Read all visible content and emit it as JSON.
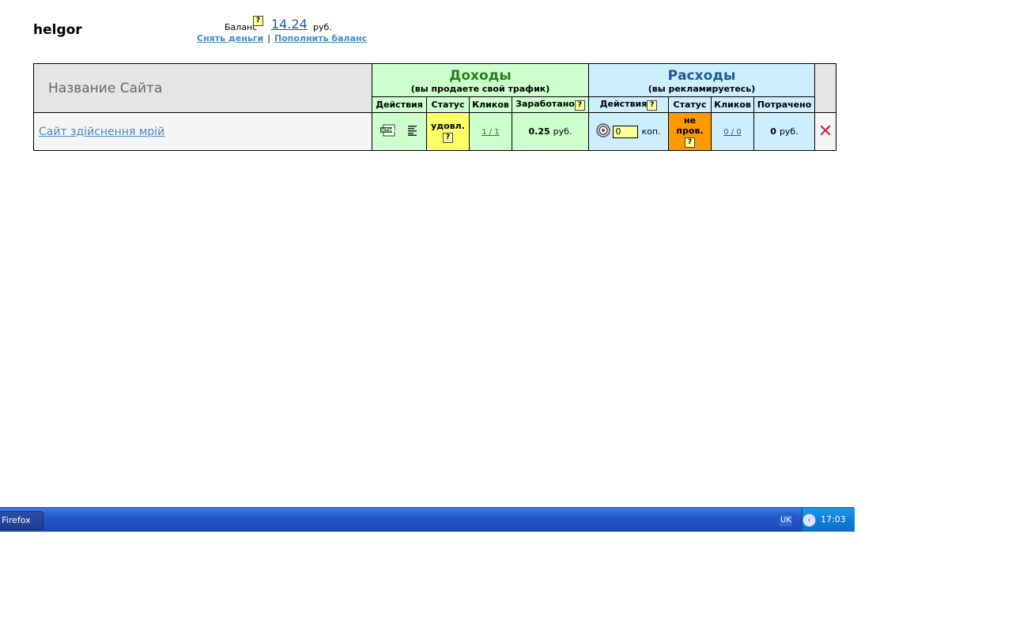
{
  "header": {
    "username": "helgor",
    "balance_label": "Баланс",
    "help_mark": "?",
    "balance_value": "14.24",
    "balance_currency": "руб.",
    "withdraw_link": "Снять деньги",
    "separator": "|",
    "topup_link": "Пополнить баланс"
  },
  "table": {
    "name_header": "Название Сайта",
    "income": {
      "title": "Доходы",
      "subtitle": "(вы продаете свой трафик)",
      "col_actions": "Действия",
      "col_status": "Статус",
      "col_clicks": "Кликов",
      "col_earned": "Заработано"
    },
    "expense": {
      "title": "Расходы",
      "subtitle": "(вы рекламируетесь)",
      "col_actions": "Действия",
      "col_status": "Статус",
      "col_clicks": "Кликов",
      "col_spent": "Потрачено"
    },
    "rows": [
      {
        "site_name": "Сайт здійснення мрій",
        "income_status": "удовл.",
        "income_clicks": "1 / 1",
        "earned_value": "0.25",
        "earned_currency": "руб.",
        "bid_value": "0",
        "bid_unit": "коп.",
        "expense_status": "не пров.",
        "expense_clicks": "0 / 0",
        "spent_value": "0",
        "spent_currency": "руб.",
        "delete_symbol": "✕"
      }
    ]
  },
  "taskbar": {
    "window_button": "a Firefox",
    "language": "UK",
    "clock": "17:03"
  },
  "colors": {
    "income_bg": "#ccffcc",
    "expense_bg": "#cceeff",
    "status_ok": "#ffff66",
    "status_warn": "#ff9900",
    "link": "#4a88c0",
    "delete": "#cc2233"
  }
}
